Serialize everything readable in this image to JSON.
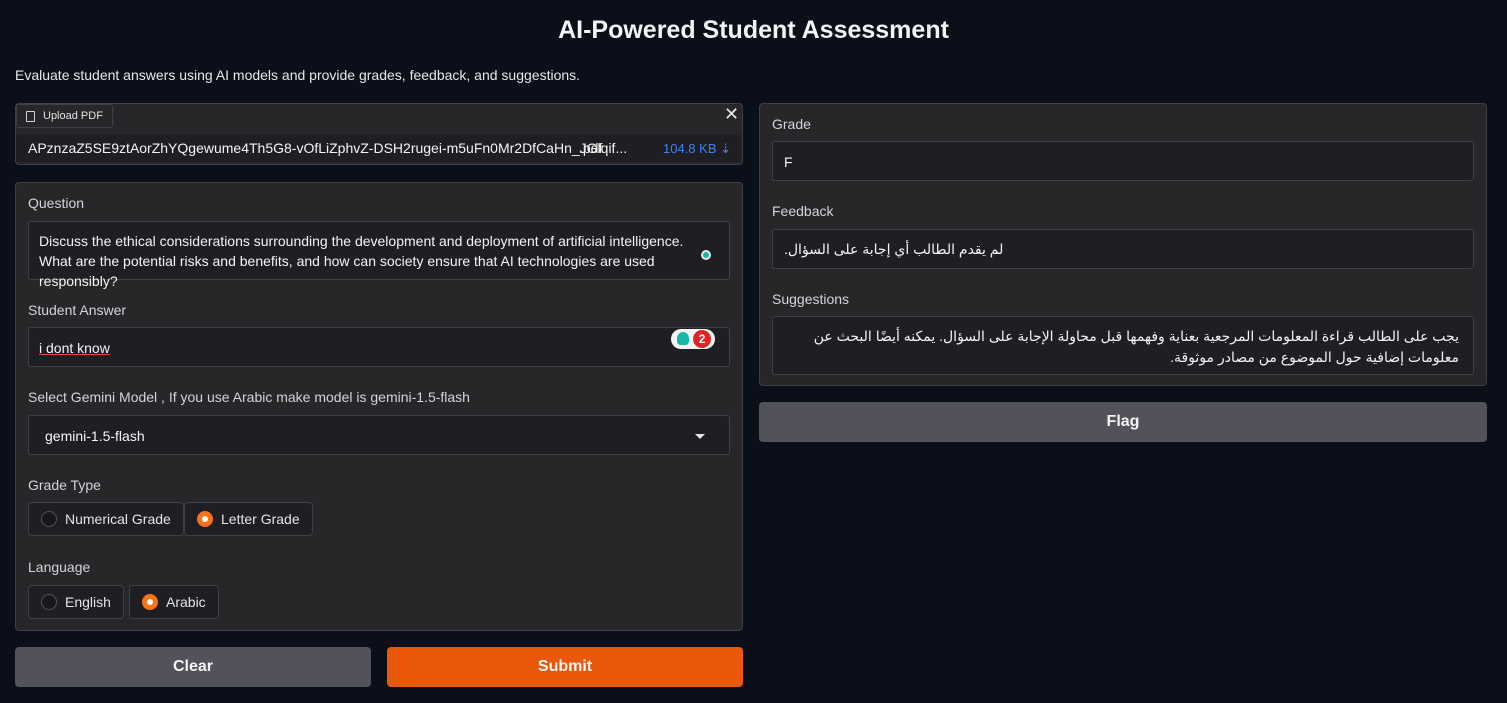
{
  "header": {
    "title": "AI-Powered Student Assessment",
    "description": "Evaluate student answers using AI models and provide grades, feedback, and suggestions."
  },
  "upload": {
    "label": "Upload PDF",
    "file_name": "APznzaZ5SE9ztAorZhYQgewume4Th5G8-vOfLiZphvZ-DSH2rugei-m5uFn0Mr2DfCaHn_JGlqif...",
    "file_ext": ".pdf",
    "file_size": "104.8 KB ⇣"
  },
  "question": {
    "label": "Question",
    "value": "Discuss the ethical considerations surrounding the development and deployment of artificial intelligence. What are the potential risks and benefits, and how can society ensure that AI technologies are used responsibly?"
  },
  "answer": {
    "label": "Student Answer",
    "value": "i dont know",
    "badge_count": "2"
  },
  "model": {
    "label": "Select Gemini Model , If you use Arabic make model is gemini-1.5-flash",
    "selected": "gemini-1.5-flash"
  },
  "grade_type": {
    "label": "Grade Type",
    "options": [
      "Numerical Grade",
      "Letter Grade"
    ],
    "selected": "Letter Grade"
  },
  "language": {
    "label": "Language",
    "options": [
      "English",
      "Arabic"
    ],
    "selected": "Arabic"
  },
  "actions": {
    "clear": "Clear",
    "submit": "Submit",
    "flag": "Flag"
  },
  "output": {
    "grade_label": "Grade",
    "grade_value": "F",
    "feedback_label": "Feedback",
    "feedback_value": "لم يقدم الطالب أي إجابة على السؤال.",
    "suggestions_label": "Suggestions",
    "suggestions_value": "يجب على الطالب قراءة المعلومات المرجعية بعناية وفهمها قبل محاولة الإجابة على السؤال. يمكنه أيضًا البحث عن معلومات إضافية حول الموضوع من مصادر موثوقة."
  },
  "colors": {
    "background": "#0b0f19",
    "accent": "#ea580c",
    "link": "#3b82f6"
  }
}
